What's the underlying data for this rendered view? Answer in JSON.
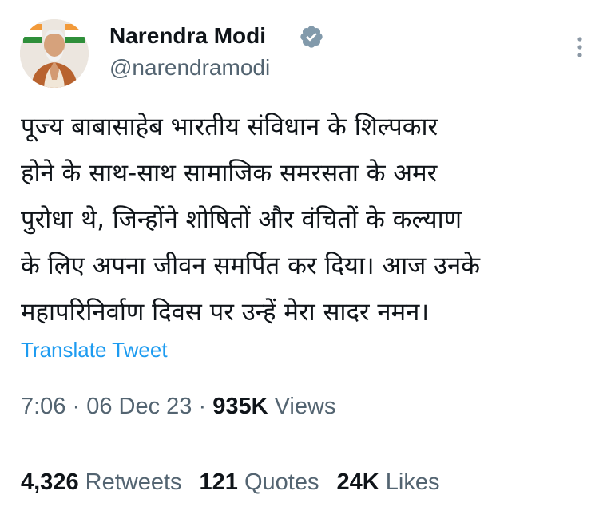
{
  "author": {
    "display_name": "Narendra Modi",
    "handle": "@narendramodi",
    "verified_icon": "verified-badge-icon",
    "avatar": "profile-photo"
  },
  "tweet": {
    "lines": [
      "पूज्य बाबासाहेब भारतीय संविधान के शिल्पकार",
      "होने के साथ-साथ सामाजिक समरसता के अमर",
      "पुरोधा थे, जिन्होंने शोषितों और वंचितों के कल्याण",
      "के लिए अपना जीवन समर्पित कर दिया। आज उनके",
      "महापरिनिर्वाण दिवस पर उन्हें मेरा सादर नमन।"
    ],
    "translate_label": "Translate Tweet"
  },
  "meta": {
    "time": "7:06",
    "sep1": " · ",
    "date": "06 Dec 23",
    "sep2": " · ",
    "views_count": "935K",
    "views_label": "Views"
  },
  "stats": {
    "retweets_count": "4,326",
    "retweets_label": "Retweets",
    "quotes_count": "121",
    "quotes_label": "Quotes",
    "likes_count": "24K",
    "likes_label": "Likes"
  },
  "colors": {
    "link": "#1d9bf0",
    "secondary_text": "#536471",
    "primary_text": "#0f1419",
    "divider": "#eff3f4"
  }
}
